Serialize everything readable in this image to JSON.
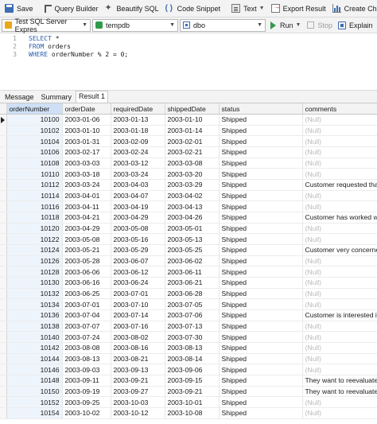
{
  "toolbar": {
    "save": "Save",
    "query_builder": "Query Builder",
    "beautify_sql": "Beautify SQL",
    "code_snippet": "Code Snippet",
    "text": "Text",
    "export_result": "Export Result",
    "create_chart": "Create Chart"
  },
  "connection": {
    "server": "Test SQL Server Expres",
    "database": "tempdb",
    "schema": "dbo",
    "run": "Run",
    "stop": "Stop",
    "explain": "Explain"
  },
  "editor": {
    "lines": [
      {
        "num": "1",
        "kw": "SELECT",
        "rest": " *"
      },
      {
        "num": "2",
        "kw": "FROM",
        "rest": " orders"
      },
      {
        "num": "3",
        "kw": "WHERE",
        "rest": " orderNumber % 2 = 0;"
      }
    ]
  },
  "tabs": [
    "Message",
    "Summary",
    "Result 1"
  ],
  "grid": {
    "columns": [
      "orderNumber",
      "orderDate",
      "requiredDate",
      "shippedDate",
      "status",
      "comments"
    ],
    "null_text": "(Null)",
    "rows": [
      [
        "10100",
        "2003-01-06",
        "2003-01-13",
        "2003-01-10",
        "Shipped",
        null
      ],
      [
        "10102",
        "2003-01-10",
        "2003-01-18",
        "2003-01-14",
        "Shipped",
        null
      ],
      [
        "10104",
        "2003-01-31",
        "2003-02-09",
        "2003-02-01",
        "Shipped",
        null
      ],
      [
        "10106",
        "2003-02-17",
        "2003-02-24",
        "2003-02-21",
        "Shipped",
        null
      ],
      [
        "10108",
        "2003-03-03",
        "2003-03-12",
        "2003-03-08",
        "Shipped",
        null
      ],
      [
        "10110",
        "2003-03-18",
        "2003-03-24",
        "2003-03-20",
        "Shipped",
        null
      ],
      [
        "10112",
        "2003-03-24",
        "2003-04-03",
        "2003-03-29",
        "Shipped",
        "Customer requested that a"
      ],
      [
        "10114",
        "2003-04-01",
        "2003-04-07",
        "2003-04-02",
        "Shipped",
        null
      ],
      [
        "10116",
        "2003-04-11",
        "2003-04-19",
        "2003-04-13",
        "Shipped",
        null
      ],
      [
        "10118",
        "2003-04-21",
        "2003-04-29",
        "2003-04-26",
        "Shipped",
        "Customer has worked with"
      ],
      [
        "10120",
        "2003-04-29",
        "2003-05-08",
        "2003-05-01",
        "Shipped",
        null
      ],
      [
        "10122",
        "2003-05-08",
        "2003-05-16",
        "2003-05-13",
        "Shipped",
        null
      ],
      [
        "10124",
        "2003-05-21",
        "2003-05-29",
        "2003-05-25",
        "Shipped",
        "Customer very concerned"
      ],
      [
        "10126",
        "2003-05-28",
        "2003-06-07",
        "2003-06-02",
        "Shipped",
        null
      ],
      [
        "10128",
        "2003-06-06",
        "2003-06-12",
        "2003-06-11",
        "Shipped",
        null
      ],
      [
        "10130",
        "2003-06-16",
        "2003-06-24",
        "2003-06-21",
        "Shipped",
        null
      ],
      [
        "10132",
        "2003-06-25",
        "2003-07-01",
        "2003-06-28",
        "Shipped",
        null
      ],
      [
        "10134",
        "2003-07-01",
        "2003-07-10",
        "2003-07-05",
        "Shipped",
        null
      ],
      [
        "10136",
        "2003-07-04",
        "2003-07-14",
        "2003-07-06",
        "Shipped",
        "Customer is interested in b"
      ],
      [
        "10138",
        "2003-07-07",
        "2003-07-16",
        "2003-07-13",
        "Shipped",
        null
      ],
      [
        "10140",
        "2003-07-24",
        "2003-08-02",
        "2003-07-30",
        "Shipped",
        null
      ],
      [
        "10142",
        "2003-08-08",
        "2003-08-16",
        "2003-08-13",
        "Shipped",
        null
      ],
      [
        "10144",
        "2003-08-13",
        "2003-08-21",
        "2003-08-14",
        "Shipped",
        null
      ],
      [
        "10146",
        "2003-09-03",
        "2003-09-13",
        "2003-09-06",
        "Shipped",
        null
      ],
      [
        "10148",
        "2003-09-11",
        "2003-09-21",
        "2003-09-15",
        "Shipped",
        "They want to reevaluate th"
      ],
      [
        "10150",
        "2003-09-19",
        "2003-09-27",
        "2003-09-21",
        "Shipped",
        "They want to reevaluate th"
      ],
      [
        "10152",
        "2003-09-25",
        "2003-10-03",
        "2003-10-01",
        "Shipped",
        null
      ],
      [
        "10154",
        "2003-10-02",
        "2003-10-12",
        "2003-10-08",
        "Shipped",
        null
      ]
    ]
  }
}
